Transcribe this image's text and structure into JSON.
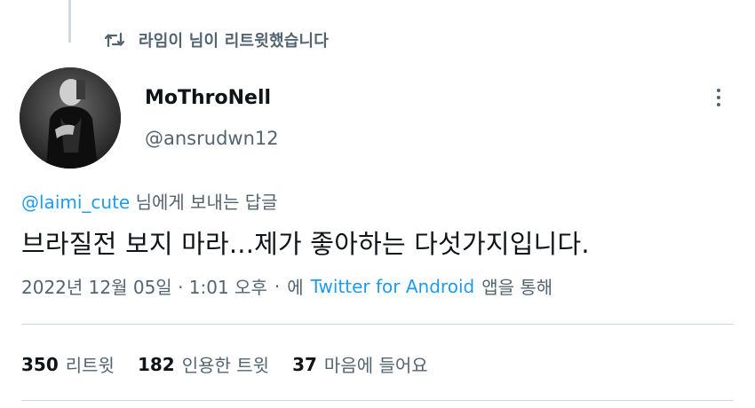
{
  "social_context": {
    "icon": "retweet-icon",
    "text": "라임이 님이 리트윗했습니다"
  },
  "author": {
    "display_name": "MoThroNell",
    "handle": "@ansrudwn12"
  },
  "reply": {
    "mention": "@laimi_cute",
    "suffix": " 님에게 보내는 답글"
  },
  "tweet": {
    "text": "브라질전 보지 마라...제가 좋아하는 다섯가지입니다."
  },
  "meta": {
    "time": "2022년 12월 05일 · 1:01 오후",
    "separator": "·",
    "via_prefix": "에",
    "client": "Twitter for Android",
    "via_suffix": "앱을 통해"
  },
  "stats": [
    {
      "count": "350",
      "label": "리트윗"
    },
    {
      "count": "182",
      "label": "인용한 트윗"
    },
    {
      "count": "37",
      "label": "마음에 들어요"
    }
  ],
  "colors": {
    "text": "#0f1419",
    "secondary": "#536471",
    "link": "#1d9bf0",
    "divider": "#cfd9de"
  }
}
